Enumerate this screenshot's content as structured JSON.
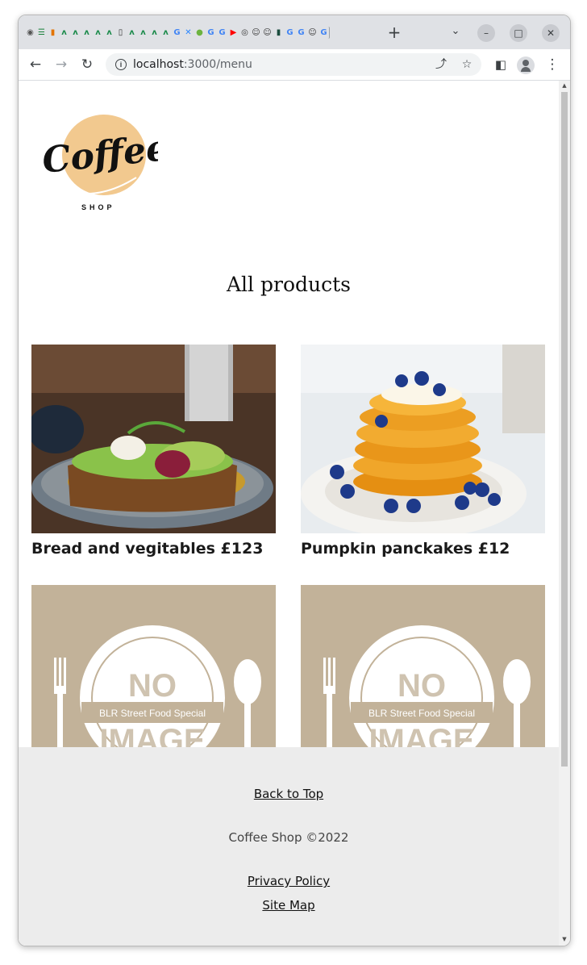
{
  "browser": {
    "url_host": "localhost",
    "url_path": ":3000/menu",
    "tab_favicons": [
      "chrome",
      "app",
      "chart",
      "n",
      "n",
      "n",
      "n",
      "n",
      "mobile",
      "n",
      "n",
      "n",
      "n",
      "G",
      "jira",
      "leaf",
      "G",
      "G",
      "youtube",
      "github",
      "person",
      "person",
      "tag",
      "G",
      "G",
      "person",
      "G"
    ]
  },
  "logo": {
    "word": "Coffee",
    "subword": "SHOP"
  },
  "page": {
    "title": "All products"
  },
  "products": [
    {
      "name": "Bread and vegitables £123"
    },
    {
      "name": "Pumpkin panckakes £12"
    },
    {
      "no_image_text": "NO",
      "no_image_banner": "BLR Street Food Special",
      "no_image_text2": "IMAGE"
    },
    {
      "no_image_text": "NO",
      "no_image_banner": "BLR Street Food Special",
      "no_image_text2": "IMAGE"
    }
  ],
  "footer": {
    "back_to_top": "Back to Top",
    "copyright": "Coffee Shop ©2022",
    "privacy": "Privacy Policy",
    "sitemap": "Site Map"
  },
  "colors": {
    "logo_circle": "#f2c98f",
    "placeholder_bg": "#c2b299",
    "footer_bg": "#ececec"
  }
}
